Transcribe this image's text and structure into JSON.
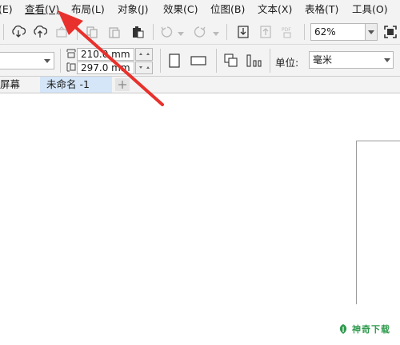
{
  "menubar": {
    "items": [
      {
        "label": "(E)"
      },
      {
        "label": "查看(V)"
      },
      {
        "label": "布局(L)"
      },
      {
        "label": "对象(J)"
      },
      {
        "label": "效果(C)"
      },
      {
        "label": "位图(B)"
      },
      {
        "label": "文本(X)"
      },
      {
        "label": "表格(T)"
      },
      {
        "label": "工具(O)"
      }
    ]
  },
  "toolbar": {
    "zoom_value": "62%",
    "icons": [
      "import-icon",
      "export-icon",
      "publish-icon",
      "copy-icon",
      "paste-icon",
      "clipboard-icon",
      "undo-icon",
      "redo-icon",
      "import-file-icon",
      "export-file-icon",
      "pdf-icon",
      "full-screen-icon"
    ]
  },
  "property_bar": {
    "width_value": "210.0 mm",
    "height_value": "297.0 mm",
    "units_label": "单位:",
    "units_value": "毫米"
  },
  "tabs": [
    {
      "label": "屏幕"
    },
    {
      "label": "未命名 -1"
    }
  ],
  "watermark": {
    "text": "神奇下载"
  },
  "colors": {
    "arrow": "#e8312c",
    "tab_active": "#d4e6f8",
    "watermark": "#2f9a4d"
  }
}
